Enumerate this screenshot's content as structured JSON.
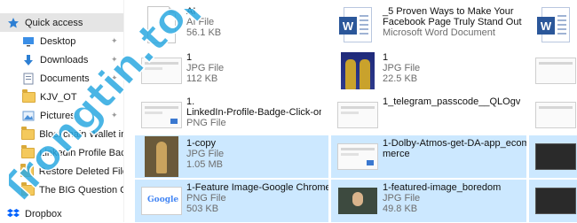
{
  "nav": {
    "items": [
      {
        "label": "Quick access",
        "icon": "star-icon",
        "pinned": false,
        "active": true
      },
      {
        "label": "Desktop",
        "icon": "desktop-icon",
        "pinned": true
      },
      {
        "label": "Downloads",
        "icon": "download-arrow-icon",
        "pinned": true
      },
      {
        "label": "Documents",
        "icon": "documents-icon",
        "pinned": true
      },
      {
        "label": "KJV_OT",
        "icon": "folder-icon",
        "pinned": false
      },
      {
        "label": "Pictures",
        "icon": "pictures-icon",
        "pinned": true
      },
      {
        "label": "Blockchain Wallet in",
        "icon": "folder-icon",
        "pinned": false
      },
      {
        "label": "Linkedin Profile Bac",
        "icon": "folder-icon",
        "pinned": false
      },
      {
        "label": "Restore Deleted File",
        "icon": "folder-icon",
        "pinned": false
      },
      {
        "label": "The BIG Question C",
        "icon": "folder-icon",
        "pinned": false
      },
      {
        "label": "Dropbox",
        "icon": "dropbox-icon",
        "pinned": false
      }
    ]
  },
  "files": [
    {
      "name": "AI",
      "type": "AI File",
      "size": "56.1 KB",
      "thumb": "generic-file"
    },
    {
      "name": "_5 Proven Ways to Make Your",
      "name2": "Facebook Page Truly Stand Out",
      "type": "Microsoft Word Document",
      "thumb": "word"
    },
    {
      "name": "1",
      "type": "JPG File",
      "size": "112 KB",
      "thumb": "screenshot"
    },
    {
      "name": "1",
      "type": "JPG File",
      "size": "22.5 KB",
      "thumb": "photo"
    },
    {
      "name": "1.",
      "name2": "LinkedIn-Profile-Badge-Click-on-...",
      "type": "PNG File",
      "thumb": "screenshot"
    },
    {
      "name": "1_telegram_passcode__QLOgv",
      "thumb": "screenshot"
    },
    {
      "name": "1-copy",
      "type": "JPG File",
      "size": "1.05 MB",
      "thumb": "figure"
    },
    {
      "name": "1-Dolby-Atmos-get-DA-app_ecom",
      "name2": "merce",
      "thumb": "screenshot"
    },
    {
      "name": "1-Feature Image-Google Chrome",
      "type": "PNG File",
      "size": "503 KB",
      "thumb": "google"
    },
    {
      "name": "1-featured-image_boredom",
      "type": "JPG File",
      "size": "49.8 KB",
      "thumb": "bored"
    }
  ],
  "colors": {
    "selection": "#cce8ff",
    "nav_active": "#e5e5e5",
    "watermark": "#2aa8e0"
  },
  "watermark": "Trongtin.top"
}
